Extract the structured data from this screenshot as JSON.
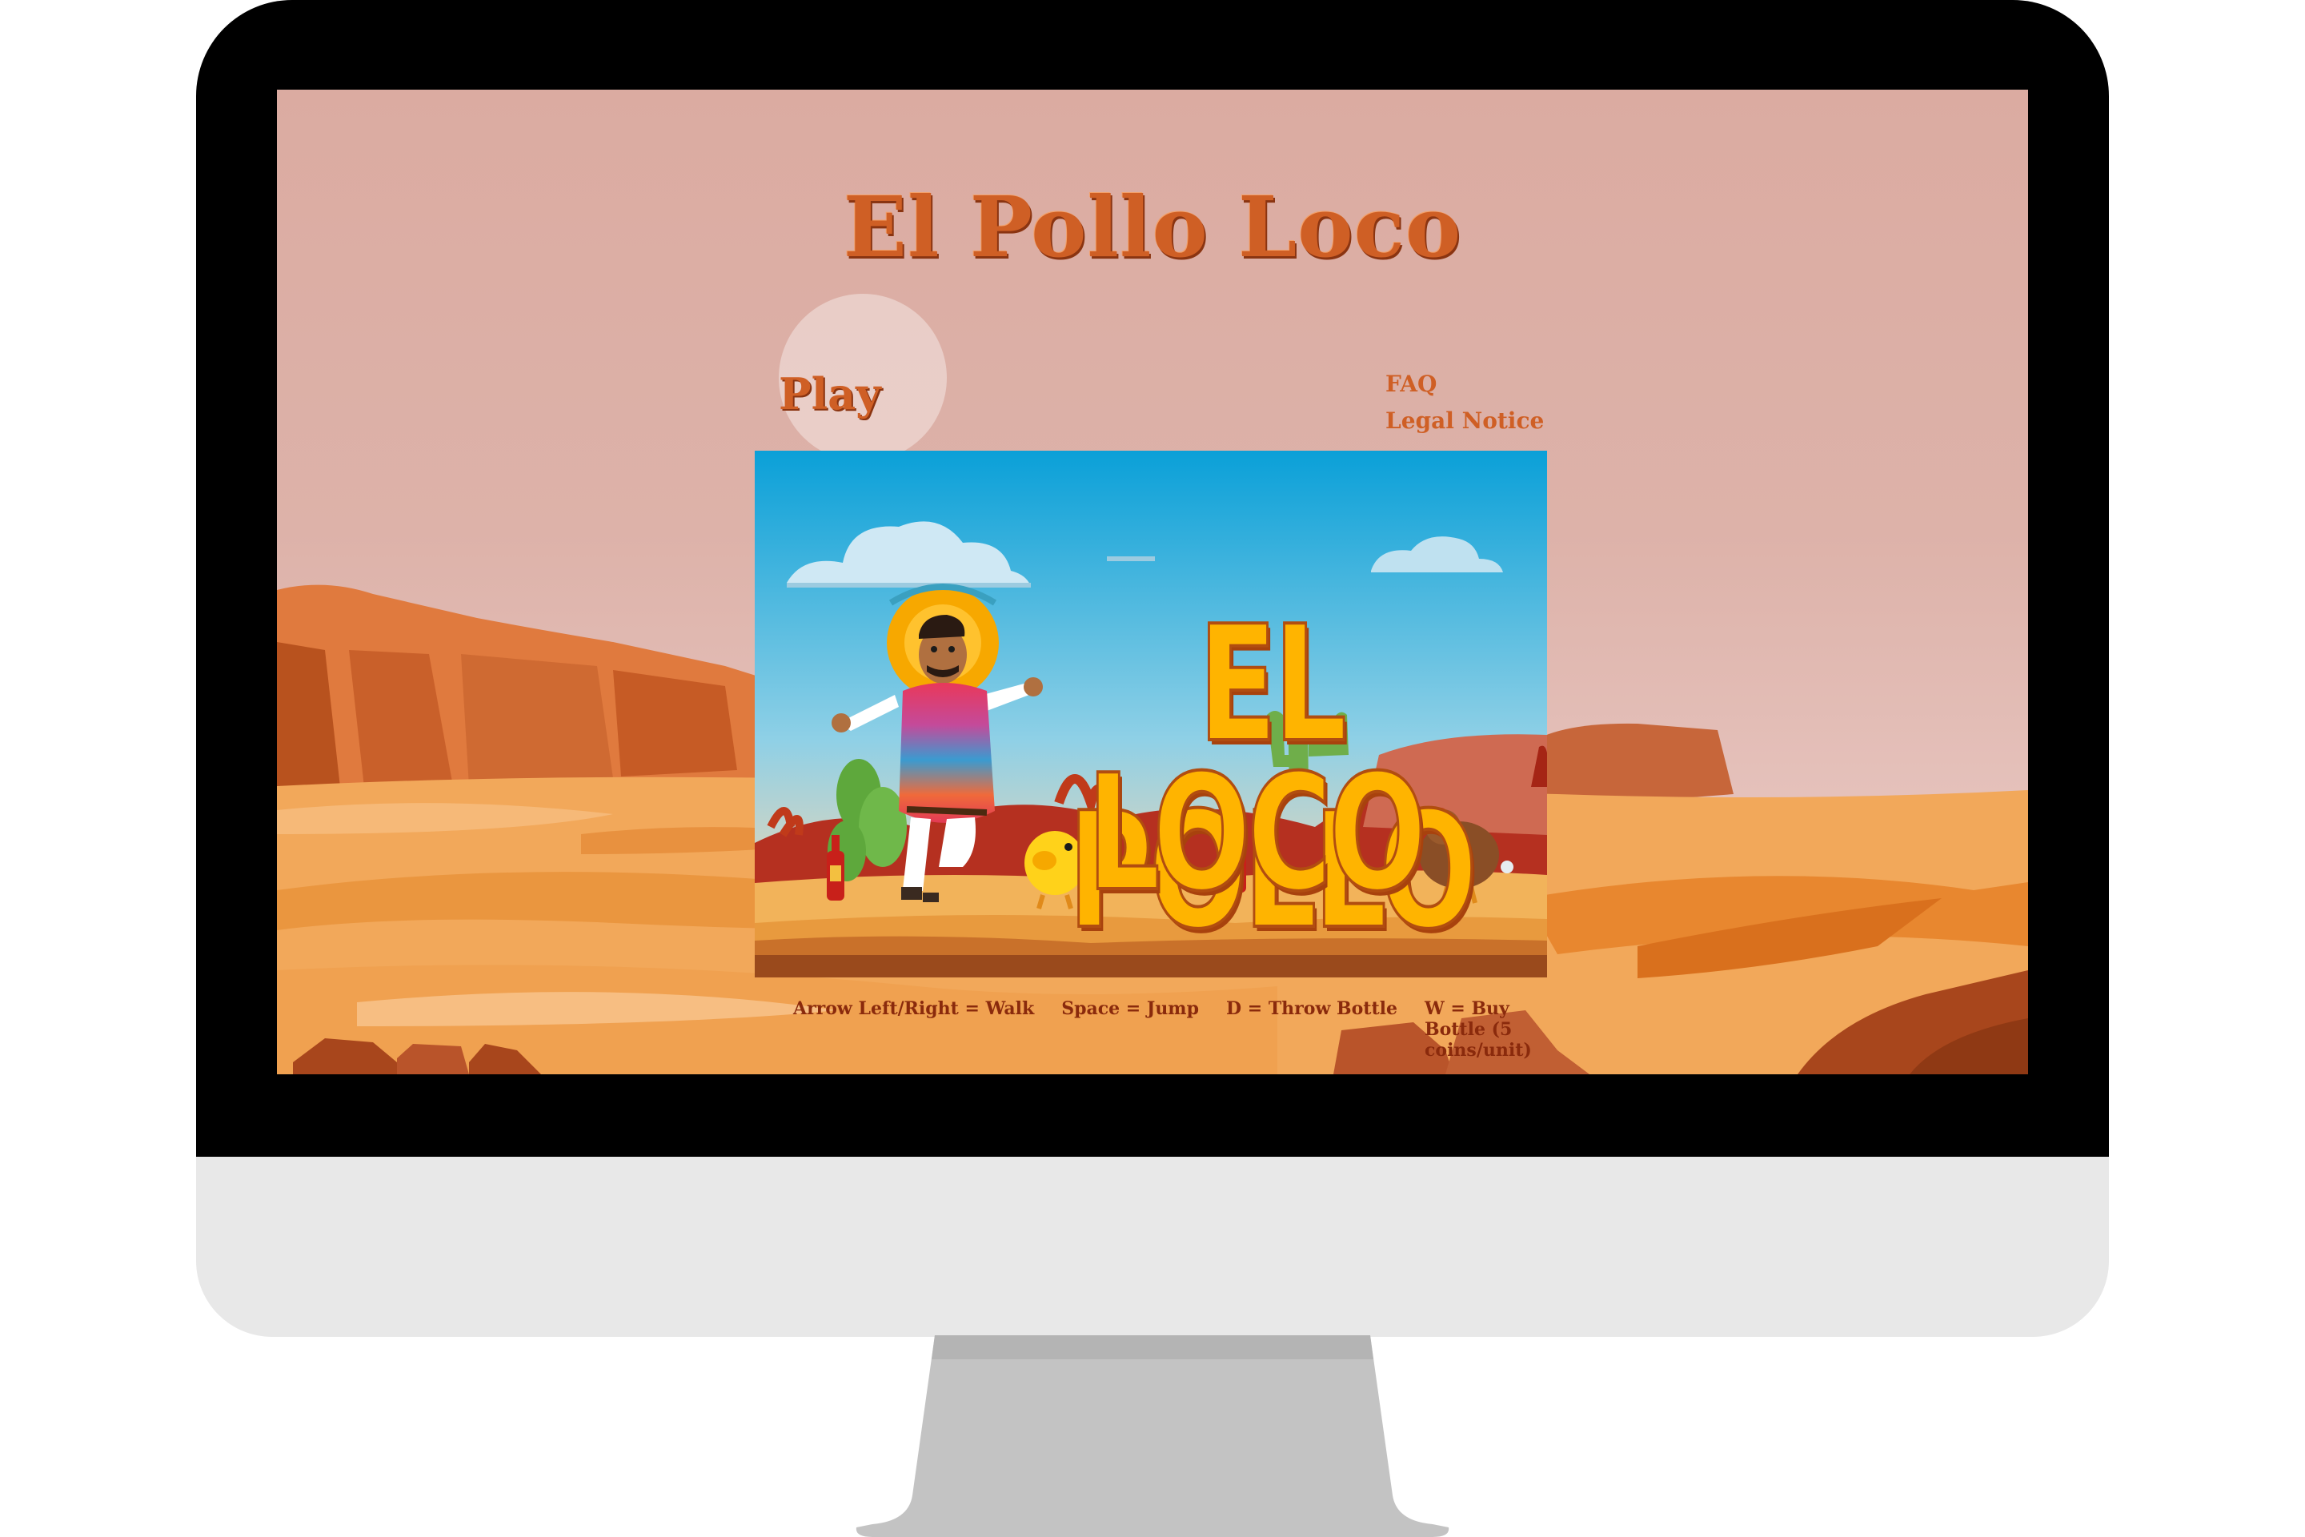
{
  "app": {
    "title": "El Pollo Loco",
    "play_label": "Play",
    "nav": [
      {
        "label": "FAQ"
      },
      {
        "label": "Legal Notice"
      }
    ]
  },
  "game_logo": {
    "line1": "EL POLLO",
    "line2": "LOCO"
  },
  "controls": [
    {
      "label": "Arrow Left/Right = Walk"
    },
    {
      "label": "Space = Jump"
    },
    {
      "label": "D = Throw Bottle"
    },
    {
      "label": "W = Buy Bottle (5 coins/unit)"
    }
  ],
  "colors": {
    "title": "#cf5f25",
    "controls": "#8a2a0c",
    "sky": "#dbaba1",
    "sand": "#f2a85a"
  }
}
